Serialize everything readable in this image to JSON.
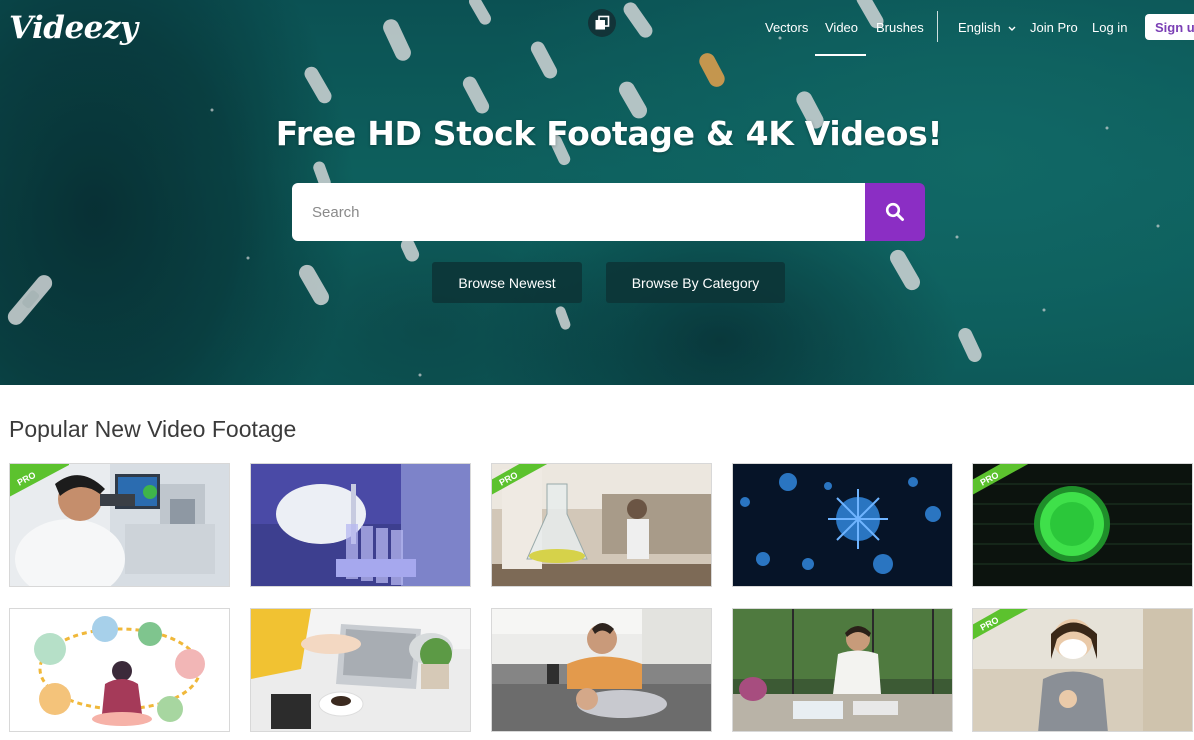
{
  "brand": {
    "logo": "Videezy"
  },
  "nav": {
    "vectors": "Vectors",
    "video": "Video",
    "brushes": "Brushes",
    "language": "English",
    "join_pro": "Join Pro",
    "login": "Log in",
    "signup": "Sign up"
  },
  "hero": {
    "title": "Free HD Stock Footage & 4K Videos!",
    "search_placeholder": "Search",
    "browse_newest": "Browse Newest",
    "browse_category": "Browse By Category"
  },
  "section": {
    "title": "Popular New Video Footage"
  },
  "thumbnails": [
    {
      "pro": true,
      "badge": "PRO",
      "subject": "scientist-microscope"
    },
    {
      "pro": false,
      "badge": "",
      "subject": "lab-pipette-tubes"
    },
    {
      "pro": true,
      "badge": "PRO",
      "subject": "lab-flask"
    },
    {
      "pro": false,
      "badge": "",
      "subject": "blue-virus"
    },
    {
      "pro": true,
      "badge": "PRO",
      "subject": "green-virus"
    },
    {
      "pro": false,
      "badge": "",
      "subject": "online-shopping-illustration"
    },
    {
      "pro": false,
      "badge": "",
      "subject": "laptop-typing"
    },
    {
      "pro": false,
      "badge": "",
      "subject": "couple-sofa-phones"
    },
    {
      "pro": false,
      "badge": "",
      "subject": "woman-cafe-coffee"
    },
    {
      "pro": true,
      "badge": "PRO",
      "subject": "woman-mask-thumbs-up"
    }
  ],
  "colors": {
    "accent": "#8b2ec4",
    "pro_badge": "#5cc22e",
    "hero_teal": "#11706c"
  }
}
